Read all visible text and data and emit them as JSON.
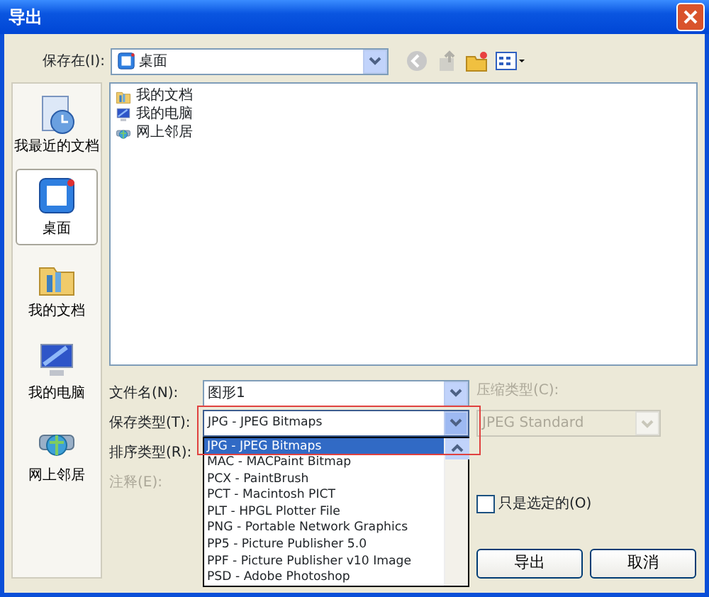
{
  "window": {
    "title": "导出"
  },
  "save_in": {
    "label": "保存在(I):",
    "value": "桌面"
  },
  "places": [
    {
      "label": "我最近的文档",
      "kind": "recent",
      "selected": false
    },
    {
      "label": "桌面",
      "kind": "desktop",
      "selected": true
    },
    {
      "label": "我的文档",
      "kind": "documents",
      "selected": false
    },
    {
      "label": "我的电脑",
      "kind": "computer",
      "selected": false
    },
    {
      "label": "网上邻居",
      "kind": "network",
      "selected": false
    }
  ],
  "files": [
    {
      "name": "我的文档",
      "kind": "documents"
    },
    {
      "name": "我的电脑",
      "kind": "computer"
    },
    {
      "name": "网上邻居",
      "kind": "network"
    }
  ],
  "form": {
    "file_name": {
      "label": "文件名(N):",
      "value": "图形1"
    },
    "save_type": {
      "label": "保存类型(T):",
      "value": "JPG - JPEG Bitmaps",
      "expanded": true,
      "highlighted": true
    },
    "sort_type": {
      "label": "排序类型(R):"
    },
    "note": {
      "label": "注释(E):",
      "disabled": true
    },
    "compression": {
      "label": "压缩类型(C):",
      "value": "JPEG Standard",
      "disabled": true
    }
  },
  "save_type_options": [
    {
      "label": "JPG - JPEG Bitmaps",
      "selected": true
    },
    {
      "label": "MAC - MACPaint Bitmap",
      "selected": false
    },
    {
      "label": "PCX - PaintBrush",
      "selected": false
    },
    {
      "label": "PCT - Macintosh PICT",
      "selected": false
    },
    {
      "label": "PLT - HPGL Plotter File",
      "selected": false
    },
    {
      "label": "PNG - Portable Network Graphics",
      "selected": false
    },
    {
      "label": "PP5 - Picture Publisher 5.0",
      "selected": false
    },
    {
      "label": "PPF - Picture Publisher v10 Image",
      "selected": false
    },
    {
      "label": "PSD - Adobe Photoshop",
      "selected": false
    }
  ],
  "only_selected": {
    "label": "只是选定的(O)",
    "checked": false
  },
  "buttons": [
    "导出",
    "取消"
  ]
}
